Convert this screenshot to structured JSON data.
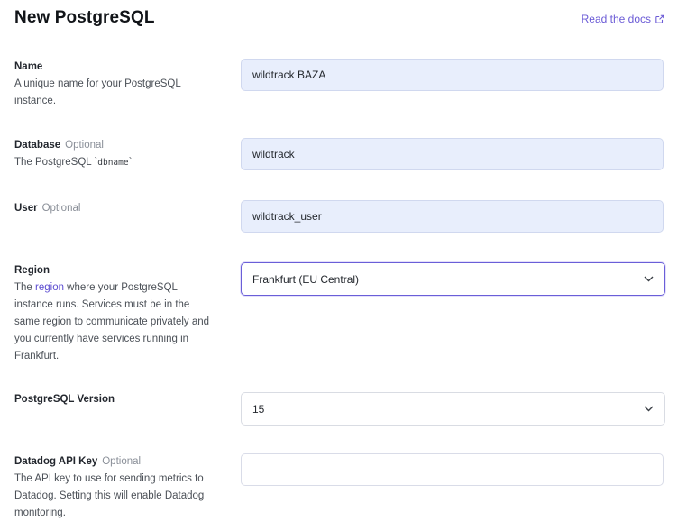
{
  "header": {
    "title": "New PostgreSQL",
    "docs_link": "Read the docs"
  },
  "fields": {
    "name": {
      "label": "Name",
      "description": "A unique name for your PostgreSQL instance.",
      "value": "wildtrack BAZA"
    },
    "database": {
      "label": "Database",
      "optional": "Optional",
      "description_prefix": "The PostgreSQL `",
      "description_code": "dbname",
      "description_suffix": "`",
      "value": "wildtrack"
    },
    "user": {
      "label": "User",
      "optional": "Optional",
      "value": "wildtrack_user"
    },
    "region": {
      "label": "Region",
      "desc_prefix": "The ",
      "desc_link": "region",
      "desc_suffix": " where your PostgreSQL instance runs. Services must be in the same region to communicate privately and you currently have services running in ",
      "desc_strong": "Frankfurt",
      "desc_end": ".",
      "selected": "Frankfurt (EU Central)"
    },
    "version": {
      "label": "PostgreSQL Version",
      "selected": "15"
    },
    "datadog": {
      "label": "Datadog API Key",
      "optional": "Optional",
      "description": "The API key to use for sending metrics to Datadog. Setting this will enable Datadog monitoring.",
      "value": ""
    }
  },
  "icons": {
    "external_link": "external-link-icon",
    "chevron": "chevron-down-icon"
  },
  "colors": {
    "accent": "#6b5bd6",
    "filled_input_bg": "#e8eefc",
    "focus_border": "#6a5fd8"
  }
}
